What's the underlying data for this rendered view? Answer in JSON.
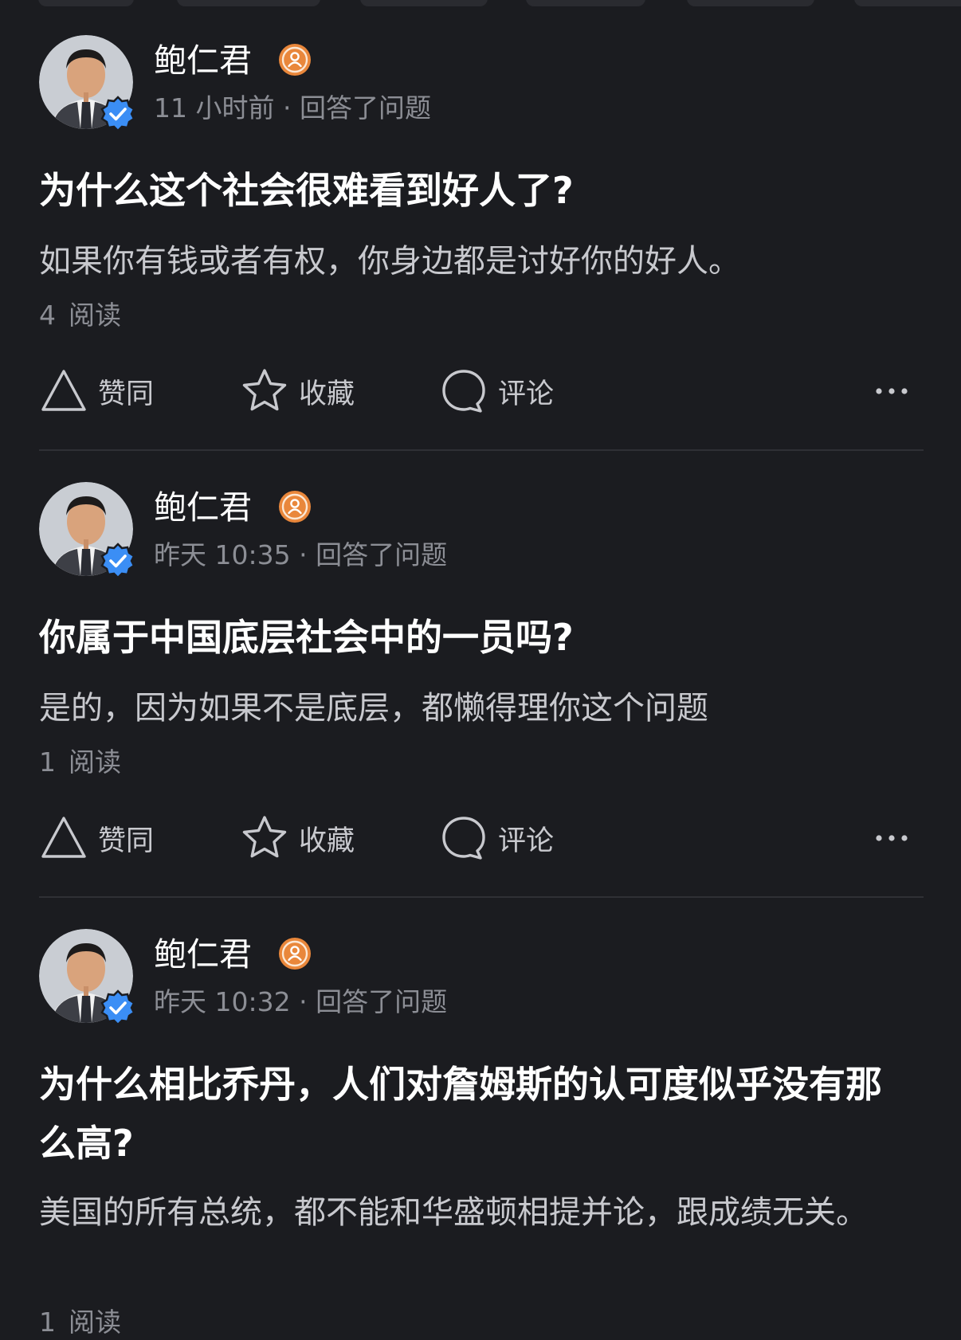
{
  "feed": {
    "items": [
      {
        "author": "鲍仁君",
        "time": "11 小时前",
        "separator": "·",
        "action": "回答了问题",
        "question": "为什么这个社会很难看到好人了?",
        "excerpt": "如果你有钱或者有权，你身边都是讨好你的好人。",
        "read_count": "4",
        "read_label": "阅读",
        "buttons": {
          "upvote": "赞同",
          "favorite": "收藏",
          "comment": "评论"
        }
      },
      {
        "author": "鲍仁君",
        "time": "昨天 10:35",
        "separator": "·",
        "action": "回答了问题",
        "question": "你属于中国底层社会中的一员吗?",
        "excerpt": "是的，因为如果不是底层，都懒得理你这个问题",
        "read_count": "1",
        "read_label": "阅读",
        "buttons": {
          "upvote": "赞同",
          "favorite": "收藏",
          "comment": "评论"
        }
      },
      {
        "author": "鲍仁君",
        "time": "昨天 10:32",
        "separator": "·",
        "action": "回答了问题",
        "question": "为什么相比乔丹，人们对詹姆斯的认可度似乎没有那么高?",
        "excerpt": "美国的所有总统，都不能和华盛顿相提并论，跟成绩无关。",
        "read_count": "1",
        "read_label": "阅读"
      }
    ]
  },
  "icons": {
    "verify": "verified-check-icon",
    "level": "user-level-badge-icon",
    "upvote": "triangle-up-icon",
    "favorite": "star-icon",
    "comment": "speech-bubble-icon",
    "more": "more-dots-icon"
  },
  "colors": {
    "background": "#1b1c20",
    "verify_blue": "#3b8ef5",
    "level_orange": "#e9873b",
    "meta_gray": "#8c8e95"
  }
}
